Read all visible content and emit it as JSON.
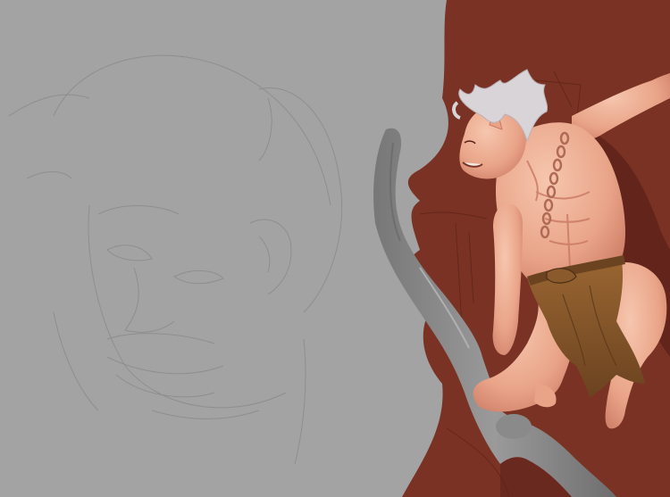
{
  "artwork": {
    "colors": {
      "canvas_gray": "#a3a3a3",
      "background_red": "#7a3224",
      "background_red_dark": "#5a2018",
      "skin": "#e9a488",
      "skin_shadow": "#c97762",
      "skin_highlight": "#f6c6ae",
      "hair": "#d9d4d8",
      "loincloth": "#8a5a2c",
      "loincloth_shadow": "#6b4320",
      "chain": "#b06a55",
      "staff_gray": "#8a8a8a",
      "staff_dark": "#6e6e6e",
      "sketch_line": "#8c8c8c"
    }
  }
}
